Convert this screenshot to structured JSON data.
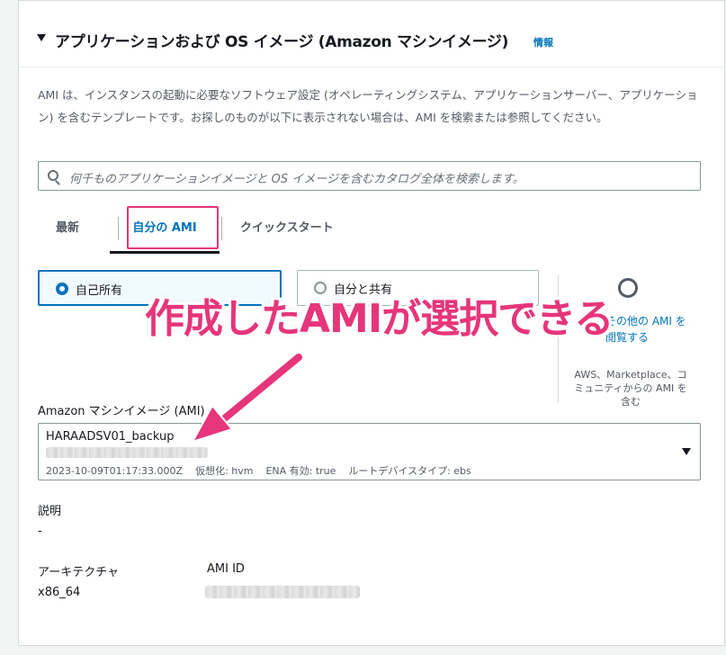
{
  "section": {
    "title": "アプリケーションおよび OS イメージ (Amazon マシンイメージ)",
    "info_link": "情報",
    "description": "AMI は、インスタンスの起動に必要なソフトウェア設定 (オペレーティングシステム、アプリケーションサーバー、アプリケーション) を含むテンプレートです。お探しのものが以下に表示されない場合は、AMI を検索または参照してください。"
  },
  "search": {
    "placeholder": "何千ものアプリケーションイメージと OS イメージを含むカタログ全体を検索します。"
  },
  "tabs": [
    {
      "label": "最新",
      "active": false
    },
    {
      "label": "自分の AMI",
      "active": true
    },
    {
      "label": "クイックスタート",
      "active": false
    }
  ],
  "ownership": {
    "options": [
      {
        "label": "自己所有",
        "selected": true
      },
      {
        "label": "自分と共有",
        "selected": false
      }
    ]
  },
  "browse": {
    "link": "その他の AMI を閲覧する",
    "subtext": "AWS、Marketplace、コミュニティからの AMI を含む"
  },
  "annotation": {
    "text": "作成したAMIが選択できる",
    "color": "#e6357a"
  },
  "ami_field": {
    "label": "Amazon マシンイメージ (AMI)",
    "selected_name": "HARAADSV01_backup",
    "meta": "2023-10-09T01:17:33.000Z    仮想化: hvm    ENA 有効: true    ルートデバイスタイプ: ebs"
  },
  "details": {
    "description_label": "説明",
    "description_value": "-",
    "architecture_label": "アーキテクチャ",
    "architecture_value": "x86_64",
    "ami_id_label": "AMI ID"
  },
  "colors": {
    "accent": "#0073bb",
    "highlight": "#e6357a",
    "text": "#16191f"
  }
}
